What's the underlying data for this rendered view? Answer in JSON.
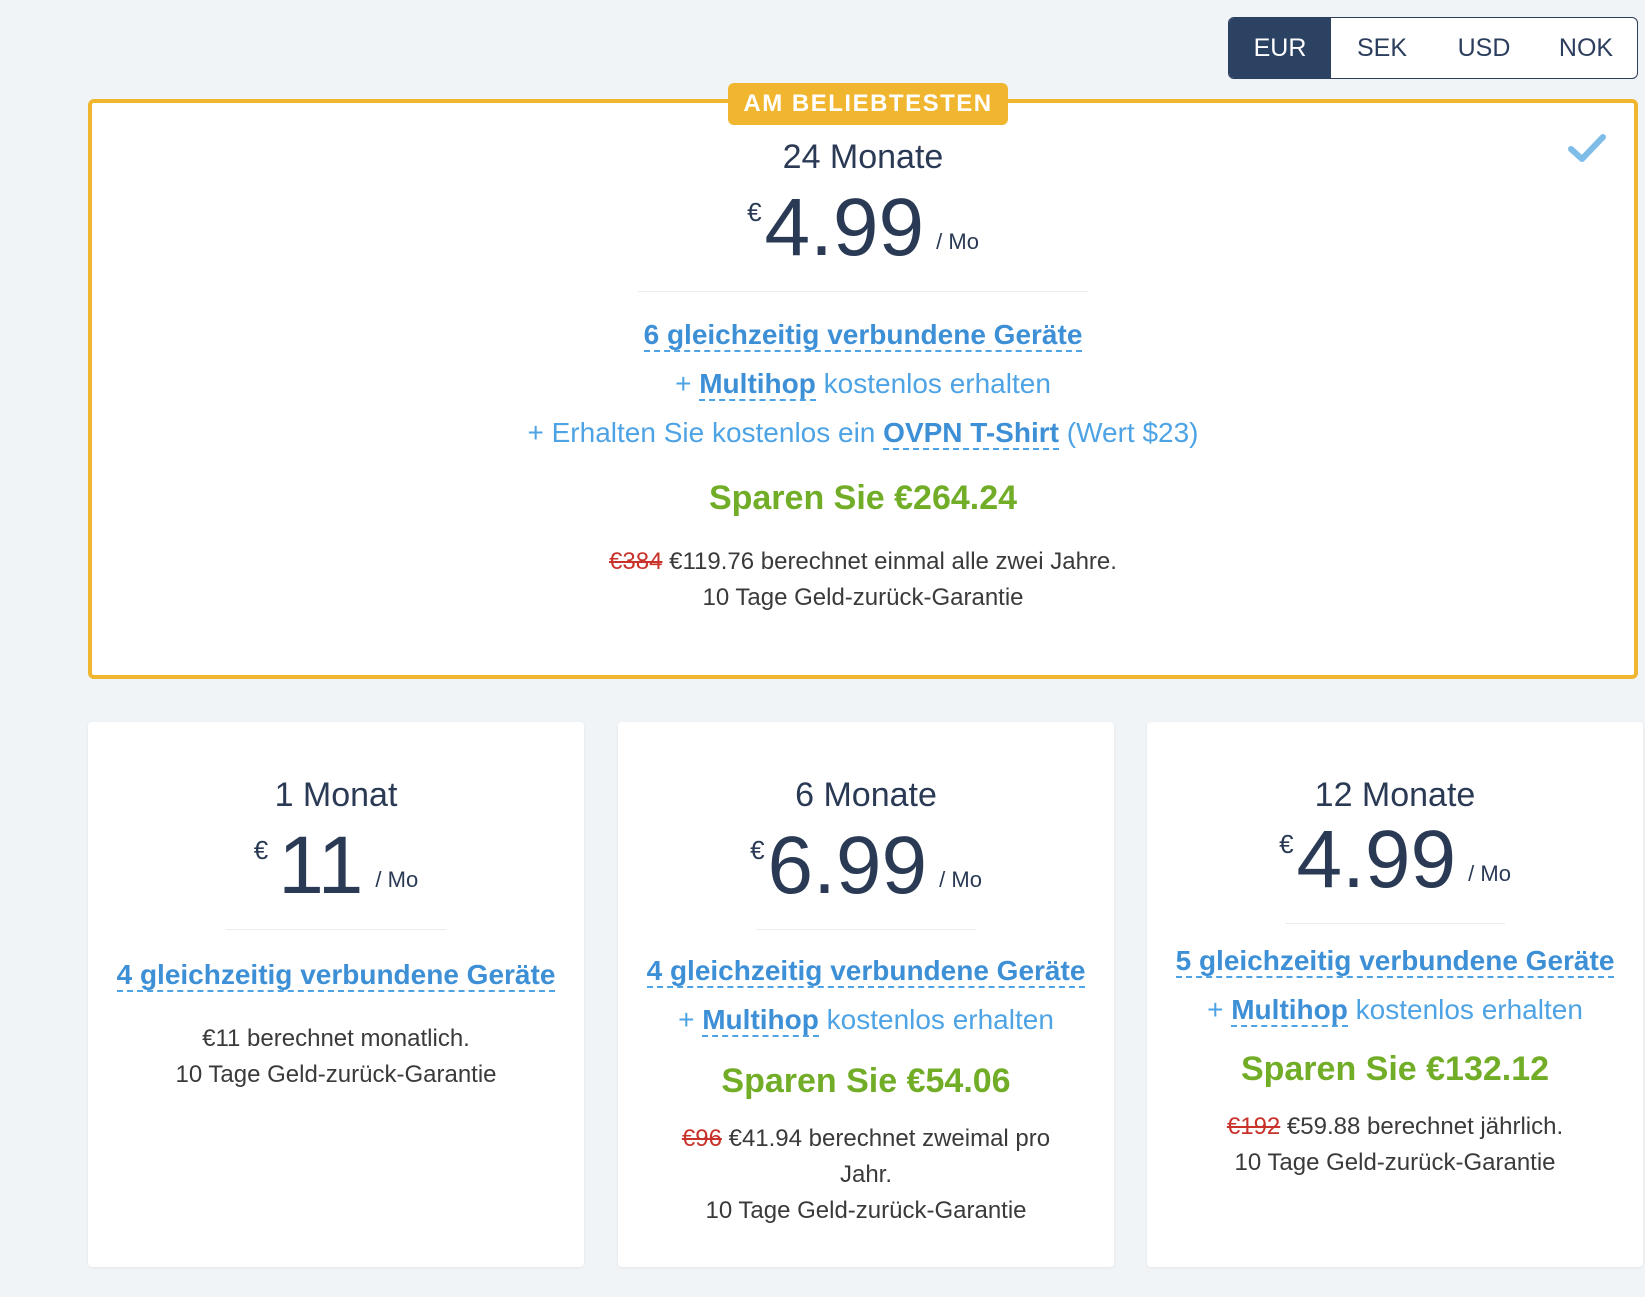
{
  "currencies": [
    {
      "label": "EUR",
      "active": true
    },
    {
      "label": "SEK",
      "active": false
    },
    {
      "label": "USD",
      "active": false
    },
    {
      "label": "NOK",
      "active": false
    }
  ],
  "featured": {
    "badge": "AM BELIEBTESTEN",
    "title": "24 Monate",
    "currency": "€",
    "price": "4.99",
    "unit": "/ Mo",
    "features": {
      "devices": "6 gleichzeitig verbundene Geräte",
      "multihop_prefix": "+ ",
      "multihop_link": "Multihop",
      "multihop_suffix": " kostenlos erhalten",
      "shirt_prefix": "+ Erhalten Sie kostenlos ein ",
      "shirt_link": "OVPN T-Shirt",
      "shirt_suffix": " (Wert $23)"
    },
    "savings": "Sparen Sie €264.24",
    "old_price": "€384",
    "billing": " €119.76 berechnet einmal alle zwei Jahre.",
    "guarantee": "10 Tage Geld-zurück-Garantie",
    "selected_icon": "checkmark-icon"
  },
  "plans": [
    {
      "title": "1 Monat",
      "currency": "€",
      "price": "11",
      "unit": "/ Mo",
      "devices": "4 gleichzeitig verbundene Geräte",
      "billing": "€11 berechnet monatlich.",
      "guarantee": "10 Tage Geld-zurück-Garantie"
    },
    {
      "title": "6 Monate",
      "currency": "€",
      "price": "6.99",
      "unit": "/ Mo",
      "devices": "4 gleichzeitig verbundene Geräte",
      "multihop_prefix": "+ ",
      "multihop_link": "Multihop",
      "multihop_suffix": " kostenlos erhalten",
      "savings": "Sparen Sie €54.06",
      "old_price": "€96",
      "billing_line1": " €41.94 berechnet zweimal pro",
      "billing_line2": "Jahr.",
      "guarantee": "10 Tage Geld-zurück-Garantie"
    },
    {
      "title": "12 Monate",
      "currency": "€",
      "price": "4.99",
      "unit": "/ Mo",
      "devices": "5 gleichzeitig verbundene Geräte",
      "multihop_prefix": "+ ",
      "multihop_link": "Multihop",
      "multihop_suffix": " kostenlos erhalten",
      "savings": "Sparen Sie €132.12",
      "old_price": "€192",
      "billing": " €59.88 berechnet jährlich.",
      "guarantee": "10 Tage Geld-zurück-Garantie"
    }
  ],
  "colors": {
    "accent_gold": "#f0b630",
    "link_blue": "#4ea3e4",
    "savings_green": "#72ad28",
    "strike_red": "#c8322a",
    "navy": "#2c4263"
  }
}
